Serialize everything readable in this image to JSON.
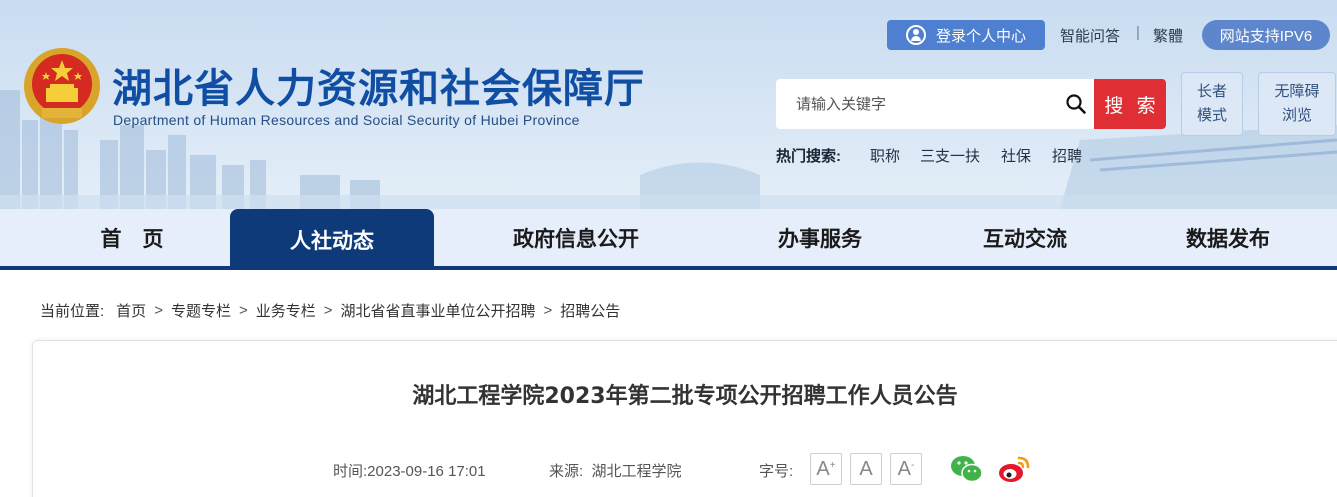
{
  "header": {
    "site_title": "湖北省人力资源和社会保障厅",
    "site_subtitle": "Department of Human Resources and Social Security of Hubei Province",
    "login_label": "登录个人中心",
    "smart_qa": "智能问答",
    "separator": "|",
    "traditional": "繁體",
    "ipv6_label": "网站支持IPV6",
    "search_placeholder": "请输入关键字",
    "search_button": "搜 索",
    "elder_mode": [
      "长者",
      "模式"
    ],
    "accessible_mode": [
      "无障碍",
      "浏览"
    ],
    "hot_label": "热门搜索:",
    "hot_searches": [
      "职称",
      "三支一扶",
      "社保",
      "招聘"
    ]
  },
  "nav": {
    "items": [
      "首　页",
      "人社动态",
      "政府信息公开",
      "办事服务",
      "互动交流",
      "数据发布"
    ],
    "active_index": 1
  },
  "breadcrumb": {
    "prefix": "当前位置:",
    "items": [
      "首页",
      "专题专栏",
      "业务专栏",
      "湖北省省直事业单位公开招聘",
      "招聘公告"
    ],
    "separator": ">"
  },
  "article": {
    "title": "湖北工程学院2023年第二批专项公开招聘工作人员公告",
    "time_label": "时间:",
    "time_value": "2023-09-16 17:01",
    "source_label": "来源:",
    "source_value": "湖北工程学院",
    "font_size_label": "字号:",
    "font_buttons": [
      "A",
      "A",
      "A"
    ],
    "font_marks": [
      "+",
      "",
      "-"
    ]
  },
  "icons": {
    "emblem": "national-emblem-icon",
    "user": "user-icon",
    "search": "search-icon",
    "wechat": "wechat-icon",
    "weibo": "weibo-icon"
  },
  "colors": {
    "primary_blue": "#0f4ea3",
    "nav_dark": "#0e3a7a",
    "search_red": "#e02e35",
    "login_blue": "#4f7fd0",
    "ipv6_blue": "#5d86cc"
  }
}
